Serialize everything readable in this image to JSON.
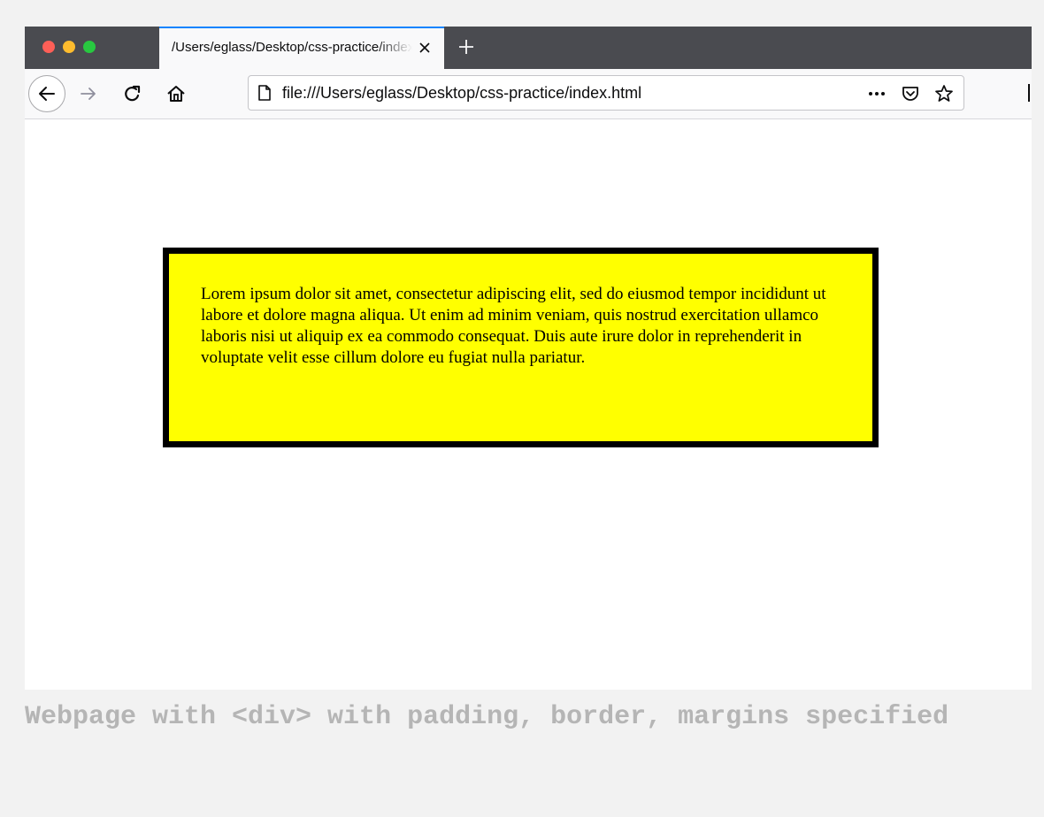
{
  "browser": {
    "tab": {
      "title": "/Users/eglass/Desktop/css-practice/index.html",
      "close_icon": "close-icon"
    },
    "new_tab_icon": "plus-icon",
    "nav": {
      "back_icon": "arrow-left-icon",
      "forward_icon": "arrow-right-icon",
      "reload_icon": "reload-icon",
      "home_icon": "home-icon"
    },
    "urlbar": {
      "page_icon": "page-icon",
      "url": "file:///Users/eglass/Desktop/css-practice/index.html",
      "actions": [
        "more-icon",
        "pocket-icon",
        "star-icon"
      ]
    },
    "accent": "#0a84ff"
  },
  "page": {
    "div_text": "Lorem ipsum dolor sit amet, consectetur adipiscing elit, sed do eiusmod tempor incididunt ut labore et dolore magna aliqua. Ut enim ad minim veniam, quis nostrud exercitation ullamco laboris nisi ut aliquip ex ea commodo consequat. Duis aute irure dolor in reprehenderit in voluptate velit esse cillum dolore eu fugiat nulla pariatur.",
    "div_background": "#ffff00",
    "div_border": "#000000"
  },
  "caption": "Webpage with <div> with padding, border, margins specified"
}
